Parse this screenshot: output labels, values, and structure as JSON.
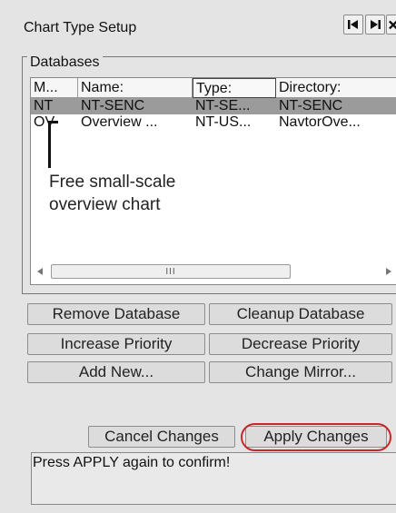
{
  "window": {
    "title": "Chart Type Setup",
    "controls": [
      "first-icon",
      "last-icon",
      "close-icon"
    ]
  },
  "databases": {
    "group_label": "Databases",
    "columns": [
      "M...",
      "Name:",
      "Type:",
      "Directory:"
    ],
    "active_column": "Type:",
    "rows": [
      {
        "m": "NT",
        "name": "NT-SENC",
        "type": "NT-SE...",
        "directory": "NT-SENC",
        "selected": true
      },
      {
        "m": "OV",
        "name": "Overview ...",
        "type": "NT-US...",
        "directory": "NavtorOve...",
        "selected": false
      }
    ],
    "callout": {
      "line1": "Free small-scale",
      "line2": "overview chart"
    },
    "scrollbar": {
      "grip": "III"
    }
  },
  "buttons": {
    "remove_database": "Remove Database",
    "cleanup_database": "Cleanup Database",
    "increase_priority": "Increase Priority",
    "decrease_priority": "Decrease Priority",
    "add_new": "Add New...",
    "change_mirror": "Change Mirror...",
    "cancel_changes": "Cancel Changes",
    "apply_changes": "Apply Changes"
  },
  "status": {
    "message": "Press APPLY again to confirm!"
  },
  "colors": {
    "panel": "#e4e4e4",
    "selected_row": "#9b9b9b",
    "highlight_ring": "#c8282a"
  }
}
